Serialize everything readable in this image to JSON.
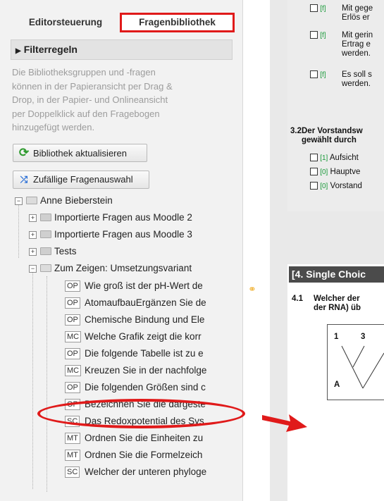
{
  "tabs": {
    "editor": "Editorsteuerung",
    "library": "Fragenbibliothek"
  },
  "filter": {
    "label": "Filterregeln",
    "chevron": "chevron-right-icon"
  },
  "help_lines": [
    "Die Bibliotheksgruppen und -fragen",
    "können in der Papieransicht per Drag &",
    "Drop, in der Papier- und Onlineansicht",
    "per Doppelklick auf den Fragebogen",
    "hinzugefügt werden."
  ],
  "buttons": {
    "refresh": {
      "label": "Bibliothek aktualisieren",
      "icon": "refresh-icon"
    },
    "random": {
      "label": "Zufällige Fragenauswahl",
      "icon": "shuffle-icon"
    }
  },
  "tree": {
    "root": "Anne Bieberstein",
    "folders": [
      "Importierte Fragen aus Moodle 2",
      "Importierte Fragen aus Moodle 3",
      "Tests",
      "Zum Zeigen: Umsetzungsvariant"
    ],
    "questions": [
      {
        "type": "OP",
        "label": "Wie groß ist der pH-Wert de"
      },
      {
        "type": "OP",
        "label": "AtomaufbauErgänzen Sie de"
      },
      {
        "type": "OP",
        "label": "Chemische Bindung und Ele"
      },
      {
        "type": "MC",
        "label": "Welche Grafik zeigt die korr"
      },
      {
        "type": "OP",
        "label": "Die folgende Tabelle ist zu e"
      },
      {
        "type": "MC",
        "label": "Kreuzen Sie in der nachfolge"
      },
      {
        "type": "OP",
        "label": "Die folgenden Größen sind c"
      },
      {
        "type": "OP",
        "label": "Bezeichnen Sie die dargeste"
      },
      {
        "type": "SC",
        "label": "Das Redoxpotential des Sys"
      },
      {
        "type": "MT",
        "label": "Ordnen Sie die Einheiten zu"
      },
      {
        "type": "MT",
        "label": "Ordnen Sie die Formelzeich"
      },
      {
        "type": "SC",
        "label": "Welcher der unteren phyloge"
      }
    ]
  },
  "document": {
    "options_top": [
      {
        "tag": "[f]",
        "lines": [
          "Mit gege",
          "Erlös er"
        ]
      },
      {
        "tag": "[f]",
        "lines": [
          "Mit gerin",
          "Ertrag e",
          "werden."
        ]
      },
      {
        "tag": "[f]",
        "lines": [
          "Es soll s",
          "werden."
        ]
      }
    ],
    "q32": {
      "num": "3.2",
      "lines": [
        "Der Vorstandsw",
        "gewählt durch"
      ]
    },
    "q32_options": [
      {
        "tag": "[1]",
        "text": "Aufsicht"
      },
      {
        "tag": "[0]",
        "text": "Hauptve"
      },
      {
        "tag": "[0]",
        "text": "Vorstand"
      }
    ],
    "section4": "[4. Single Choic",
    "q41": {
      "num": "4.1",
      "lines": [
        "Welcher der",
        "der RNA) üb"
      ]
    },
    "tree_labels": [
      "1",
      "3",
      "A"
    ]
  },
  "colors": {
    "highlight": "#e01a1a",
    "accent_green": "#1a9a3a"
  }
}
